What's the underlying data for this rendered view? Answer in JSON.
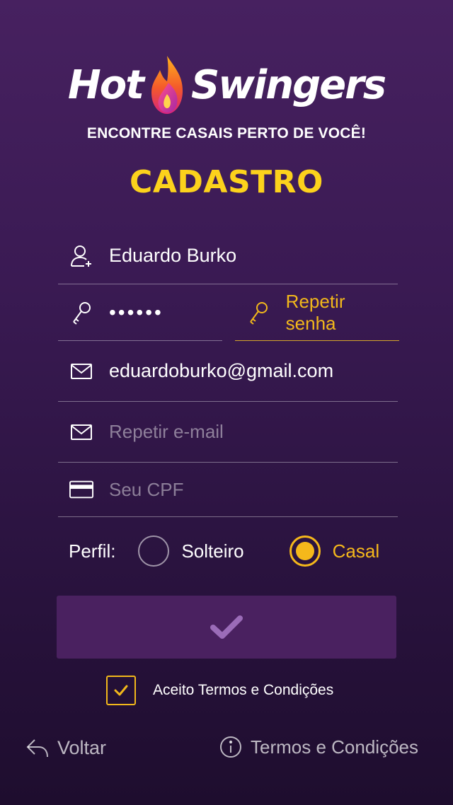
{
  "app": {
    "logo_left": "Hot",
    "logo_right": "Swingers",
    "tagline": "ENCONTRE CASAIS PERTO DE VOCÊ!",
    "title": "CADASTRO"
  },
  "form": {
    "name_value": "Eduardo Burko",
    "password_value": "••••••",
    "repeat_password_placeholder": "Repetir senha",
    "email_value": "eduardoburko@gmail.com",
    "repeat_email_placeholder": "Repetir e-mail",
    "cpf_placeholder": "Seu CPF"
  },
  "profile": {
    "label": "Perfil:",
    "options": [
      {
        "label": "Solteiro",
        "selected": false
      },
      {
        "label": "Casal",
        "selected": true
      }
    ]
  },
  "terms": {
    "checkbox_label": "Aceito Termos e Condições",
    "checked": true
  },
  "footer": {
    "back_label": "Voltar",
    "terms_link_label": "Termos e Condições"
  },
  "colors": {
    "accent": "#fcd21c",
    "accent_orange": "#f5b81b",
    "background_top": "#472160",
    "background_bottom": "#1e0d2e",
    "button_bg": "#4a2160",
    "check_icon": "#9b6cb8"
  },
  "icons": {
    "user": "add-user-icon",
    "key": "key-icon",
    "mail": "mail-icon",
    "card": "credit-card-icon",
    "submit": "check-icon",
    "back": "reply-arrow-icon",
    "info": "info-icon",
    "logo": "flame-icon"
  }
}
